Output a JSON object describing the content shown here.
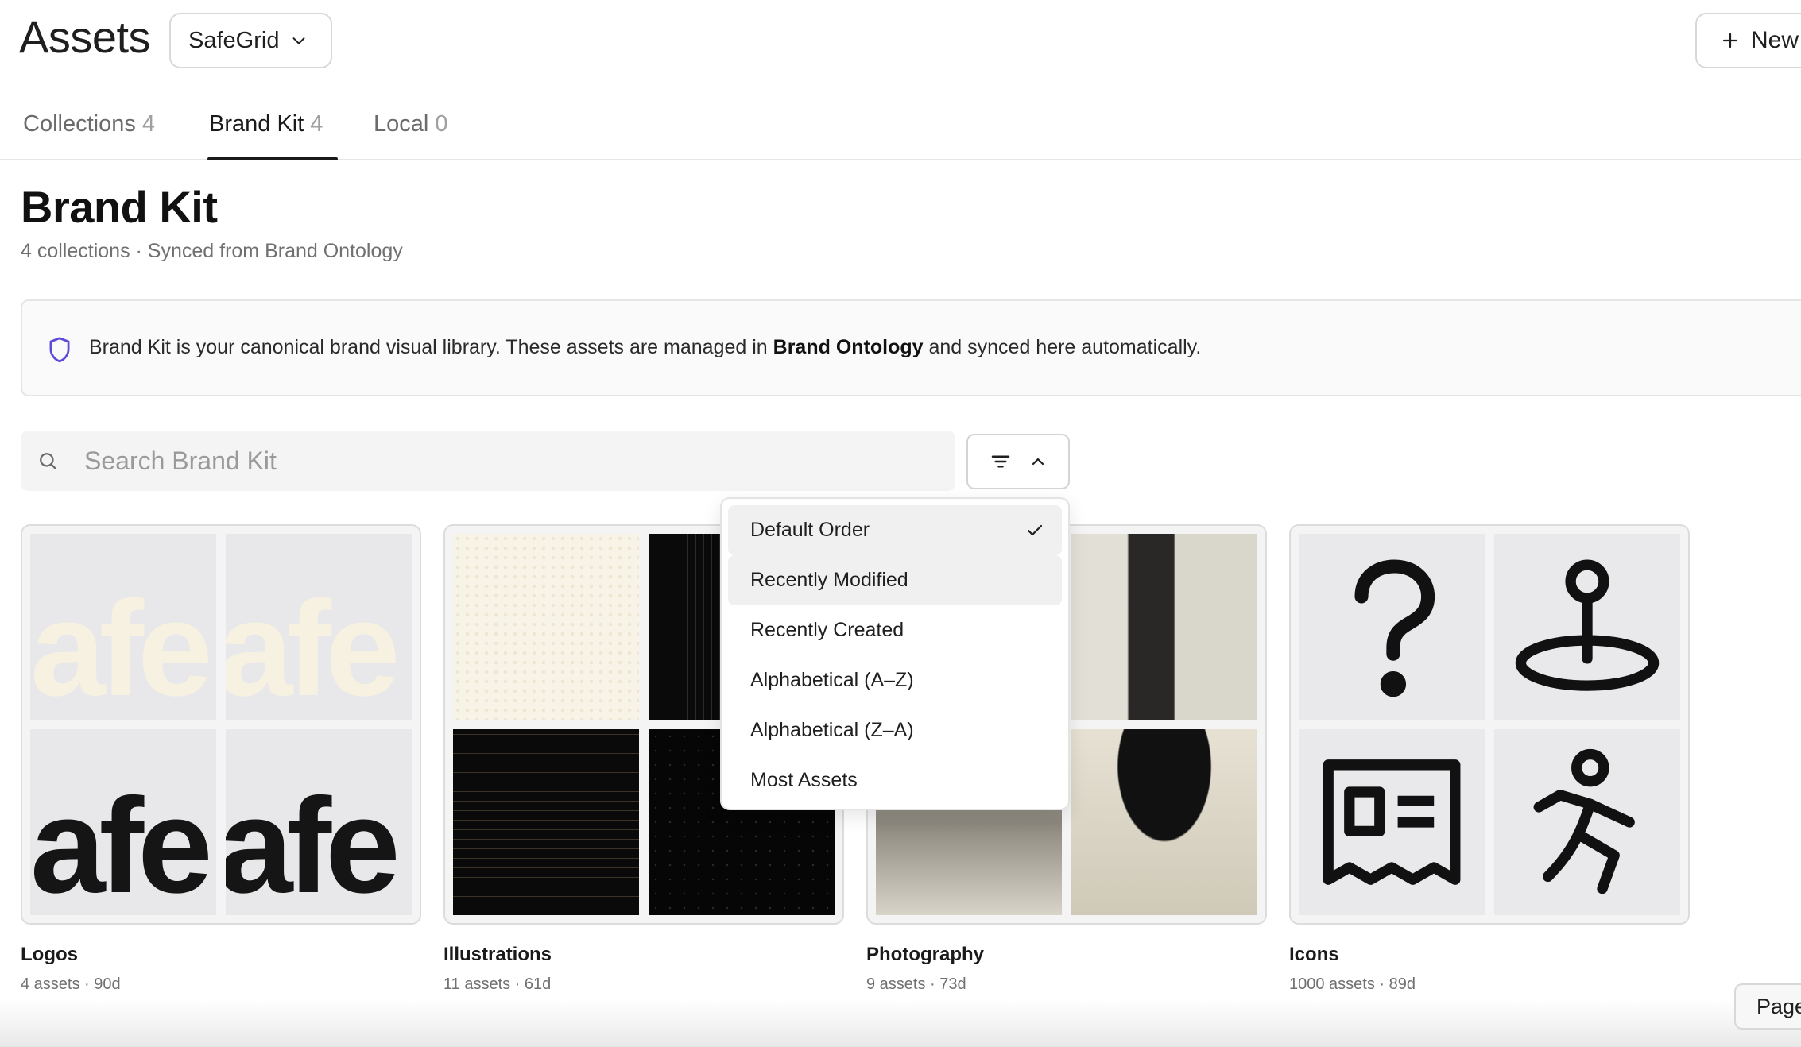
{
  "header": {
    "title": "Assets",
    "workspace": "SafeGrid",
    "new_label": "New"
  },
  "tabs": [
    {
      "label": "Collections",
      "count": "4"
    },
    {
      "label": "Brand Kit",
      "count": "4"
    },
    {
      "label": "Local",
      "count": "0"
    }
  ],
  "section": {
    "title": "Brand Kit",
    "subtitle": "4 collections · Synced from Brand Ontology"
  },
  "banner": {
    "text_before": "Brand Kit is your canonical brand visual library. These assets are managed in ",
    "text_bold": "Brand Ontology",
    "text_after": " and synced here automatically."
  },
  "search": {
    "placeholder": "Search Brand Kit",
    "value": ""
  },
  "sort_menu": {
    "selected": "Default Order",
    "options": [
      "Default Order",
      "Recently Modified",
      "Recently Created",
      "Alphabetical (A–Z)",
      "Alphabetical (Z–A)",
      "Most Assets"
    ]
  },
  "cards": [
    {
      "name": "Logos",
      "meta": "4 assets · 90d",
      "logo_text": "afe"
    },
    {
      "name": "Illustrations",
      "meta": "11 assets · 61d"
    },
    {
      "name": "Photography",
      "meta": "9 assets · 73d"
    },
    {
      "name": "Icons",
      "meta": "1000 assets · 89d"
    }
  ],
  "page_chip": "Page",
  "colors": {
    "accent_shield": "#5b4bd6",
    "text_primary": "#1a1a1a",
    "text_muted": "#707070",
    "menu_highlight": "#f0f0f0"
  },
  "icons": [
    "chevron-down-icon",
    "plus-icon",
    "shield-icon",
    "search-icon",
    "filter-icon",
    "chevron-up-icon",
    "check-icon",
    "question-icon",
    "location-pin-icon",
    "id-card-icon",
    "running-person-icon"
  ]
}
